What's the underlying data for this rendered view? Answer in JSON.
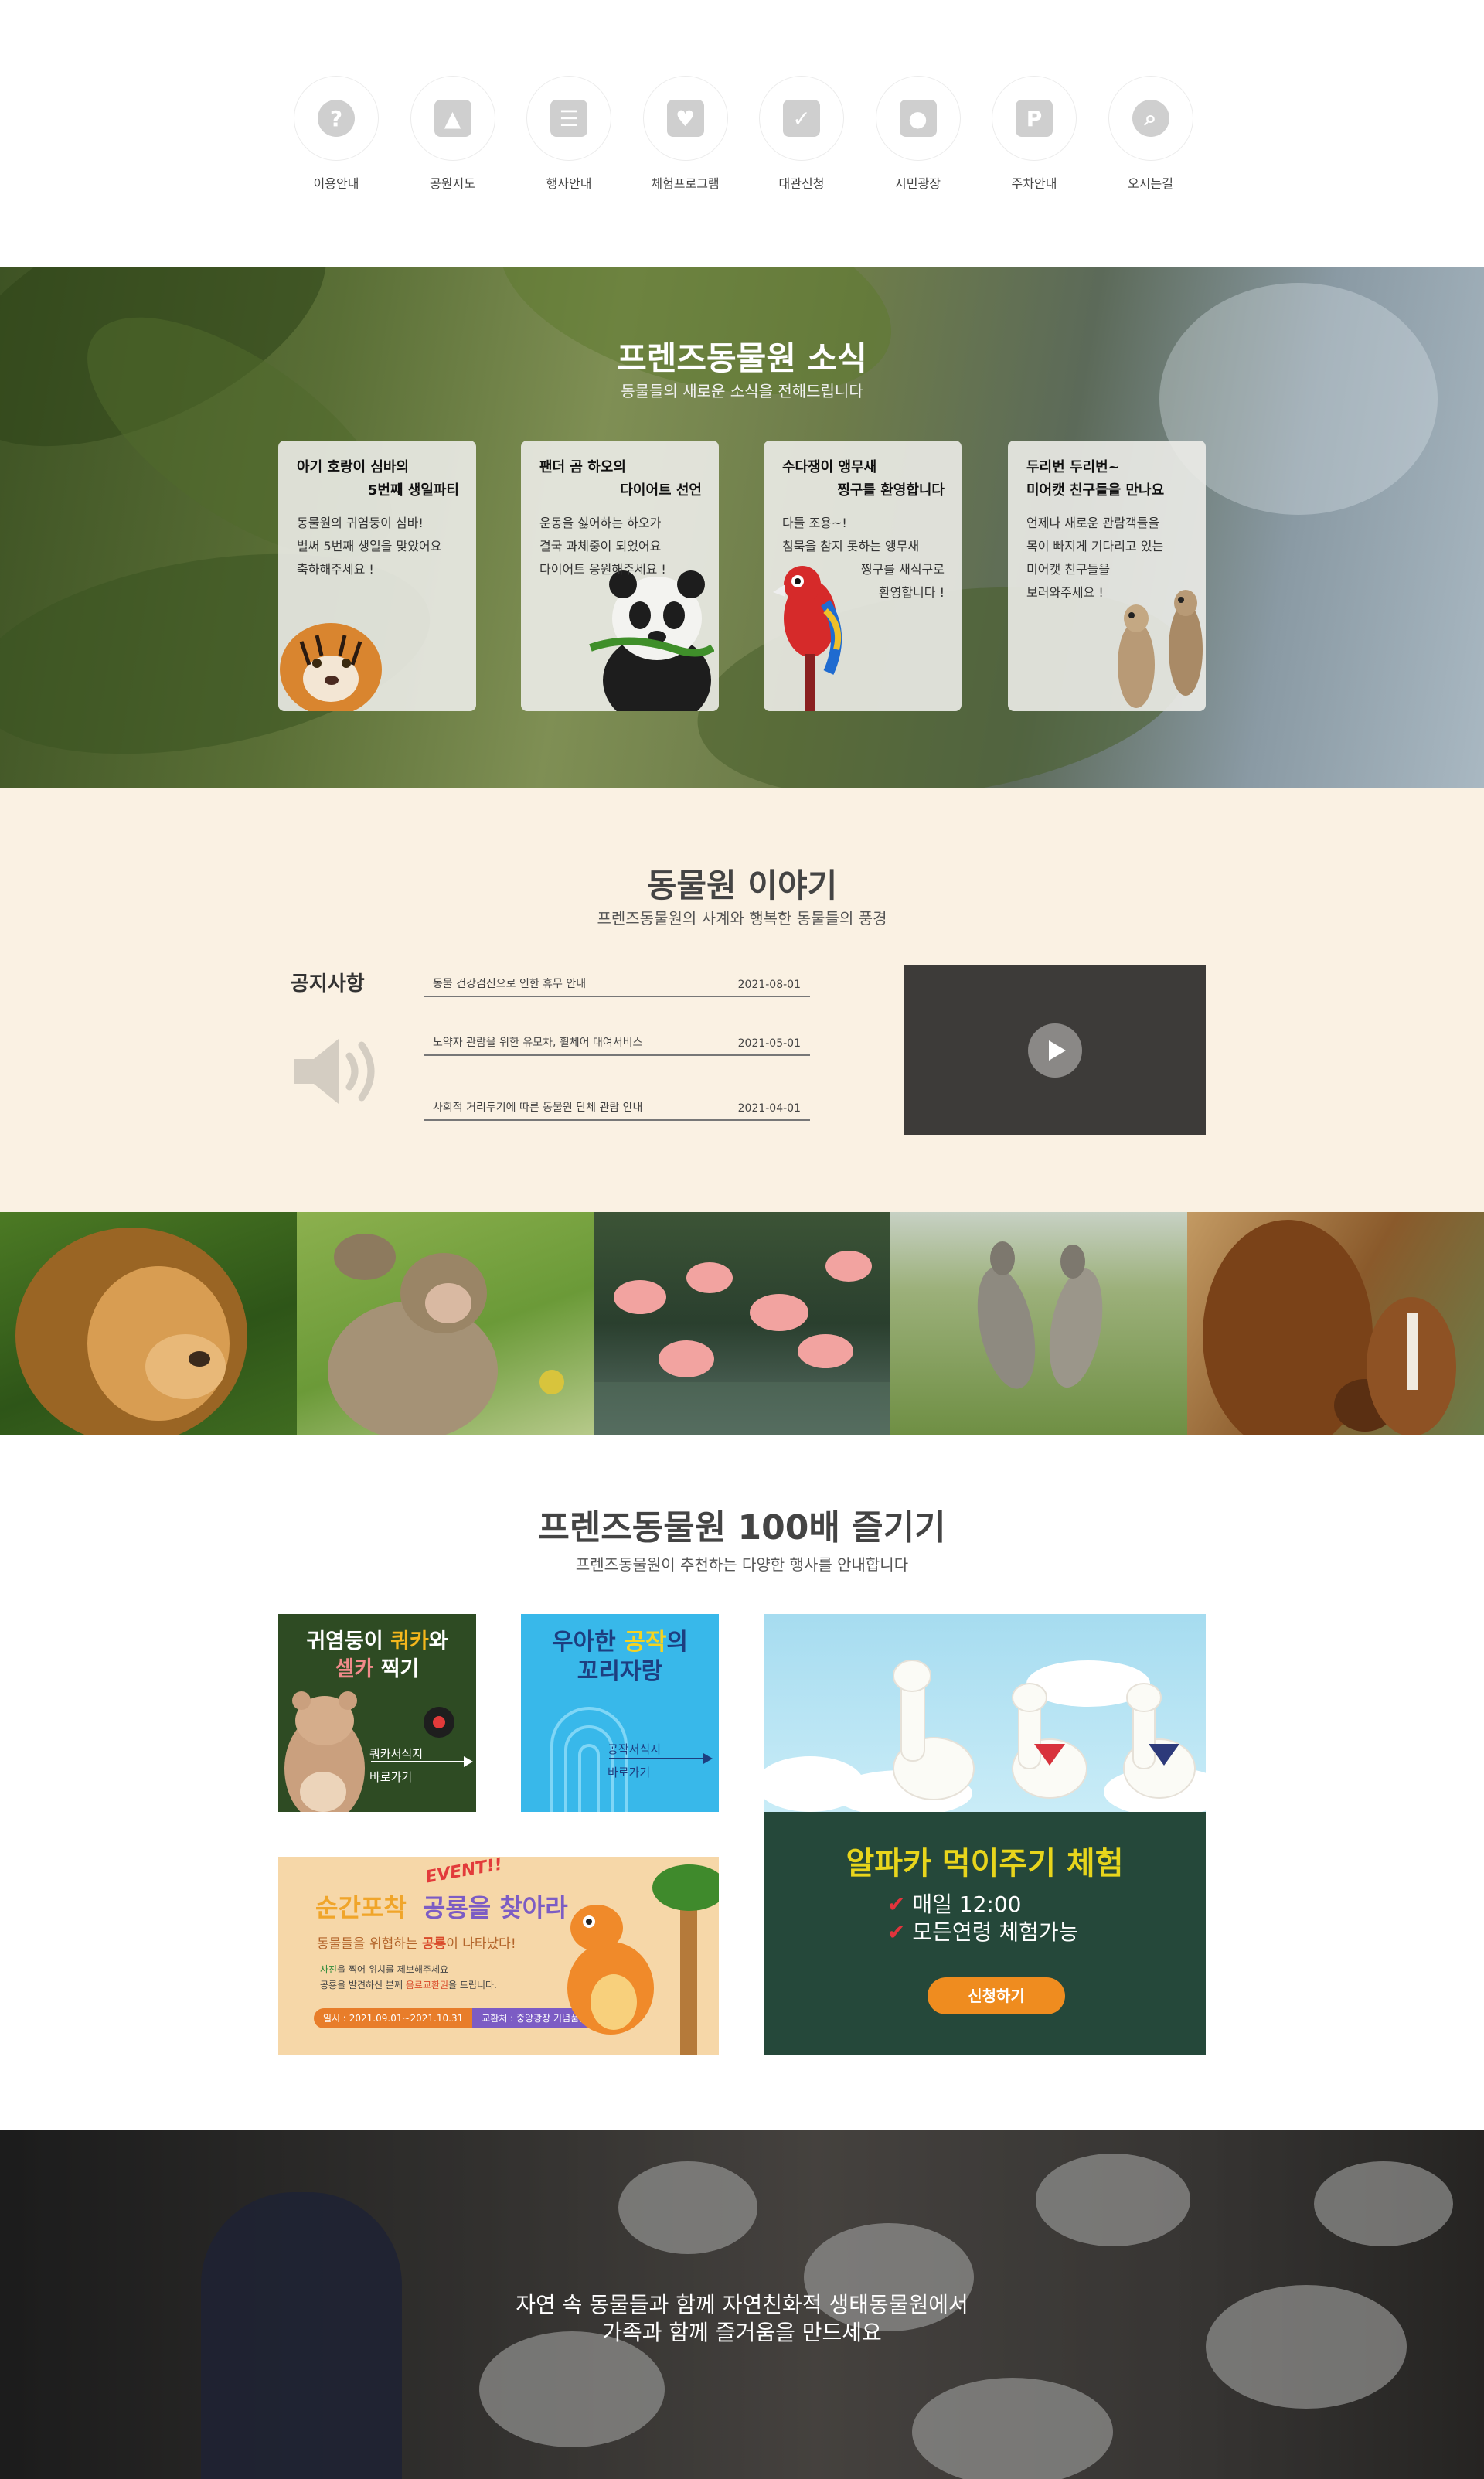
{
  "quick_menu": [
    {
      "label": "이용안내",
      "icon": "question-icon",
      "glyph": "?"
    },
    {
      "label": "공원지도",
      "icon": "map-icon",
      "glyph": "▲"
    },
    {
      "label": "행사안내",
      "icon": "event-list-icon",
      "glyph": "☰"
    },
    {
      "label": "체험프로그램",
      "icon": "hand-heart-icon",
      "glyph": "♥"
    },
    {
      "label": "대관신청",
      "icon": "calendar-check-icon",
      "glyph": "✓"
    },
    {
      "label": "시민광장",
      "icon": "person-plaza-icon",
      "glyph": "●"
    },
    {
      "label": "주차안내",
      "icon": "parking-icon",
      "glyph": "P"
    },
    {
      "label": "오시는길",
      "icon": "directions-search-icon",
      "glyph": "⌕"
    }
  ],
  "news": {
    "title": "프렌즈동물원 소식",
    "subtitle": "동물들의 새로운 소식을 전해드립니다",
    "cards": [
      {
        "title_line1": "아기 호랑이 심바의",
        "title_line2": "5번째 생일파티",
        "body": [
          "동물원의 귀염둥이 심바!",
          "벌써 5번째 생일을 맞았어요",
          "축하해주세요 !"
        ]
      },
      {
        "title_line1": "팬더 곰 하오의",
        "title_line2": "다이어트 선언",
        "body": [
          "운동을 싫어하는 하오가",
          "결국 과체중이 되었어요",
          "다이어트 응원해주세요 !"
        ]
      },
      {
        "title_line1": "수다쟁이 앵무새",
        "title_line2": "찡구를 환영합니다",
        "body": [
          "다들 조용~!",
          "침묵을 참지 못하는 앵무새",
          "찡구를 새식구로",
          "환영합니다 !"
        ]
      },
      {
        "title_line1": "두리번 두리번~",
        "title_line2": "미어캣 친구들을 만나요",
        "body": [
          "언제나 새로운 관람객들을",
          "목이 빠지게 기다리고 있는",
          "미어캣 친구들을",
          "보러와주세요 !"
        ]
      }
    ]
  },
  "story": {
    "title": "동물원 이야기",
    "subtitle": "프렌즈동물원의 사계와 행복한 동물들의 풍경",
    "notice_heading": "공지사항",
    "notices": [
      {
        "title": "동물 건강검진으로 인한 휴무 안내",
        "date": "2021-08-01"
      },
      {
        "title": "노약자 관람을 위한 유모차, 휠체어 대여서비스",
        "date": "2021-05-01"
      },
      {
        "title": "사회적 거리두기에 따른 동물원 단체 관람 안내",
        "date": "2021-04-01"
      }
    ]
  },
  "gallery": [
    "lion",
    "monkey",
    "flamingo",
    "kangaroo",
    "horse"
  ],
  "enjoy": {
    "title": "프렌즈동물원 100배 즐기기",
    "subtitle": "프렌즈동물원이 추천하는 다양한 행사를 안내합니다",
    "quokka": {
      "line1a": "귀염둥이 ",
      "line1b": "쿼카",
      "line1c": "와",
      "line2a": "셀카",
      "line2b": " 찍기",
      "link1": "쿼카서식지",
      "link2": "바로가기"
    },
    "peacock": {
      "line1a": "우아한 ",
      "line1b": "공작",
      "line1c": "의",
      "line2": "꼬리자랑",
      "link1": "공작서식지",
      "link2": "바로가기"
    },
    "dino": {
      "event": "EVENT!!",
      "title_a": "순간포착",
      "title_b": "공룡을 찾아라",
      "sub_a": "동물들을 위협하는 ",
      "sub_b": "공룡",
      "sub_c": "이 나타났다!",
      "l1a": "사진",
      "l1b": "을 찍어 위치를 제보해주세요",
      "l2a": "공룡을 발견하신 분께 ",
      "l2b": "음료교환권",
      "l2c": "을 드립니다.",
      "date": "일시 : 2021.09.01~2021.10.31",
      "place": "교환처 : 중앙광장 기념품샵"
    },
    "alpaca": {
      "title": "알파카 먹이주기 체험",
      "item1": "매일 12:00",
      "item2": "모든연령 체험가능",
      "button": "신청하기"
    }
  },
  "bottom": {
    "line1": "자연 속 동물들과 함께 자연친화적 생태동물원에서",
    "line2": "가족과 함께 즐거움을 만드세요"
  },
  "colors": {
    "cream": "#faf1e3",
    "alpaca_green": "#25483a",
    "alpaca_yellow": "#e8d51c",
    "orange": "#ef8c1f"
  }
}
